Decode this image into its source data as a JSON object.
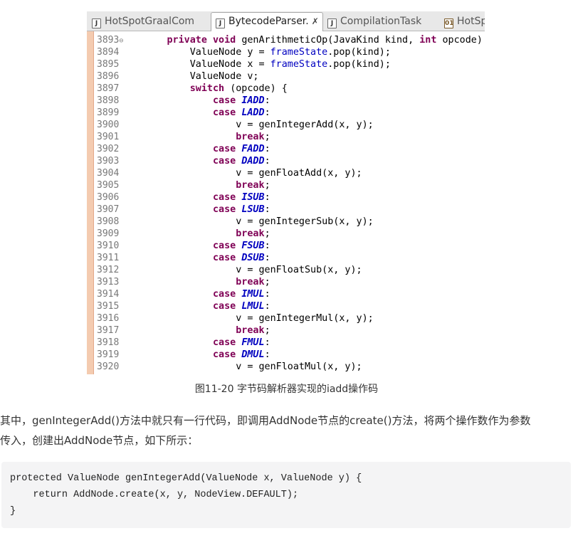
{
  "tabs": [
    {
      "label": "HotSpotGraalCom",
      "icon": "java-file-icon",
      "active": false
    },
    {
      "label": "BytecodeParser.",
      "icon": "java-file-icon",
      "active": true,
      "close": "✗"
    },
    {
      "label": "CompilationTask",
      "icon": "java-file-icon",
      "active": false
    },
    {
      "label": "HotSp",
      "icon": "class-file-icon",
      "active": false
    }
  ],
  "code_lines": [
    {
      "n": "3893",
      "mark": "⊖",
      "t": [
        [
          "        ",
          ""
        ],
        [
          "private void ",
          "kw"
        ],
        [
          "genArithmeticOp(JavaKind kind, ",
          ""
        ],
        [
          "int ",
          "kw"
        ],
        [
          "opcode) {",
          ""
        ]
      ]
    },
    {
      "n": "3894",
      "t": [
        [
          "            ValueNode y = ",
          ""
        ],
        [
          "frameState",
          "fld"
        ],
        [
          ".pop(kind);",
          ""
        ]
      ]
    },
    {
      "n": "3895",
      "t": [
        [
          "            ValueNode x = ",
          ""
        ],
        [
          "frameState",
          "fld"
        ],
        [
          ".pop(kind);",
          ""
        ]
      ]
    },
    {
      "n": "3896",
      "t": [
        [
          "            ValueNode v;",
          ""
        ]
      ]
    },
    {
      "n": "3897",
      "t": [
        [
          "            ",
          ""
        ],
        [
          "switch ",
          "kw"
        ],
        [
          "(opcode) {",
          ""
        ]
      ]
    },
    {
      "n": "3898",
      "t": [
        [
          "                ",
          ""
        ],
        [
          "case ",
          "kw"
        ],
        [
          "IADD",
          "cst"
        ],
        [
          ":",
          ""
        ]
      ]
    },
    {
      "n": "3899",
      "t": [
        [
          "                ",
          ""
        ],
        [
          "case ",
          "kw"
        ],
        [
          "LADD",
          "cst"
        ],
        [
          ":",
          ""
        ]
      ]
    },
    {
      "n": "3900",
      "t": [
        [
          "                    v = genIntegerAdd(x, y);",
          ""
        ]
      ]
    },
    {
      "n": "3901",
      "t": [
        [
          "                    ",
          ""
        ],
        [
          "break",
          "kw"
        ],
        [
          ";",
          ""
        ]
      ]
    },
    {
      "n": "3902",
      "t": [
        [
          "                ",
          ""
        ],
        [
          "case ",
          "kw"
        ],
        [
          "FADD",
          "cst"
        ],
        [
          ":",
          ""
        ]
      ]
    },
    {
      "n": "3903",
      "t": [
        [
          "                ",
          ""
        ],
        [
          "case ",
          "kw"
        ],
        [
          "DADD",
          "cst"
        ],
        [
          ":",
          ""
        ]
      ]
    },
    {
      "n": "3904",
      "t": [
        [
          "                    v = genFloatAdd(x, y);",
          ""
        ]
      ]
    },
    {
      "n": "3905",
      "t": [
        [
          "                    ",
          ""
        ],
        [
          "break",
          "kw"
        ],
        [
          ";",
          ""
        ]
      ]
    },
    {
      "n": "3906",
      "t": [
        [
          "                ",
          ""
        ],
        [
          "case ",
          "kw"
        ],
        [
          "ISUB",
          "cst"
        ],
        [
          ":",
          ""
        ]
      ]
    },
    {
      "n": "3907",
      "t": [
        [
          "                ",
          ""
        ],
        [
          "case ",
          "kw"
        ],
        [
          "LSUB",
          "cst"
        ],
        [
          ":",
          ""
        ]
      ]
    },
    {
      "n": "3908",
      "t": [
        [
          "                    v = genIntegerSub(x, y);",
          ""
        ]
      ]
    },
    {
      "n": "3909",
      "t": [
        [
          "                    ",
          ""
        ],
        [
          "break",
          "kw"
        ],
        [
          ";",
          ""
        ]
      ]
    },
    {
      "n": "3910",
      "t": [
        [
          "                ",
          ""
        ],
        [
          "case ",
          "kw"
        ],
        [
          "FSUB",
          "cst"
        ],
        [
          ":",
          ""
        ]
      ]
    },
    {
      "n": "3911",
      "t": [
        [
          "                ",
          ""
        ],
        [
          "case ",
          "kw"
        ],
        [
          "DSUB",
          "cst"
        ],
        [
          ":",
          ""
        ]
      ]
    },
    {
      "n": "3912",
      "t": [
        [
          "                    v = genFloatSub(x, y);",
          ""
        ]
      ]
    },
    {
      "n": "3913",
      "t": [
        [
          "                    ",
          ""
        ],
        [
          "break",
          "kw"
        ],
        [
          ";",
          ""
        ]
      ]
    },
    {
      "n": "3914",
      "t": [
        [
          "                ",
          ""
        ],
        [
          "case ",
          "kw"
        ],
        [
          "IMUL",
          "cst"
        ],
        [
          ":",
          ""
        ]
      ]
    },
    {
      "n": "3915",
      "t": [
        [
          "                ",
          ""
        ],
        [
          "case ",
          "kw"
        ],
        [
          "LMUL",
          "cst"
        ],
        [
          ":",
          ""
        ]
      ]
    },
    {
      "n": "3916",
      "t": [
        [
          "                    v = genIntegerMul(x, y);",
          ""
        ]
      ]
    },
    {
      "n": "3917",
      "t": [
        [
          "                    ",
          ""
        ],
        [
          "break",
          "kw"
        ],
        [
          ";",
          ""
        ]
      ]
    },
    {
      "n": "3918",
      "t": [
        [
          "                ",
          ""
        ],
        [
          "case ",
          "kw"
        ],
        [
          "FMUL",
          "cst"
        ],
        [
          ":",
          ""
        ]
      ]
    },
    {
      "n": "3919",
      "t": [
        [
          "                ",
          ""
        ],
        [
          "case ",
          "kw"
        ],
        [
          "DMUL",
          "cst"
        ],
        [
          ":",
          ""
        ]
      ]
    },
    {
      "n": "3920",
      "t": [
        [
          "                    v = genFloatMul(x, y);",
          ""
        ]
      ]
    }
  ],
  "caption": "图11-20 字节码解析器实现的iadd操作码",
  "paragraph": {
    "line1": "其中，genIntegerAdd()方法中就只有一行代码，即调用AddNode节点的create()方法，将两个操作数作为参数",
    "line2": "传入，创建出AddNode节点，如下所示："
  },
  "code_block": [
    "protected ValueNode genIntegerAdd(ValueNode x, ValueNode y) {",
    "    return AddNode.create(x, y, NodeView.DEFAULT);",
    "}"
  ],
  "colors": {
    "keyword": "#7f0055",
    "field": "#0000c0",
    "ruler": "#f4cbb0",
    "code_bg": "#f4f4f5"
  }
}
